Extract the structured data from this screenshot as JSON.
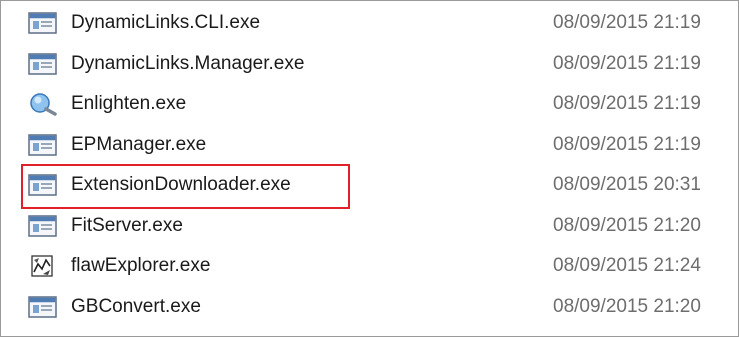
{
  "colors": {
    "highlight": "#e0202a",
    "date_text": "#6d6d6d",
    "name_text": "#1a1a1a"
  },
  "files": [
    {
      "name": "DynamicLinks.CLI.exe",
      "modified": "08/09/2015 21:19",
      "icon": "application-window-icon"
    },
    {
      "name": "DynamicLinks.Manager.exe",
      "modified": "08/09/2015 21:19",
      "icon": "application-window-icon"
    },
    {
      "name": "Enlighten.exe",
      "modified": "08/09/2015 21:19",
      "icon": "magnifier-app-icon"
    },
    {
      "name": "EPManager.exe",
      "modified": "08/09/2015 21:19",
      "icon": "application-window-icon"
    },
    {
      "name": "ExtensionDownloader.exe",
      "modified": "08/09/2015 20:31",
      "icon": "application-window-icon",
      "highlighted": true
    },
    {
      "name": "FitServer.exe",
      "modified": "08/09/2015 21:20",
      "icon": "application-window-icon"
    },
    {
      "name": "flawExplorer.exe",
      "modified": "08/09/2015 21:24",
      "icon": "chart-app-icon"
    },
    {
      "name": "GBConvert.exe",
      "modified": "08/09/2015 21:20",
      "icon": "application-window-icon"
    }
  ]
}
